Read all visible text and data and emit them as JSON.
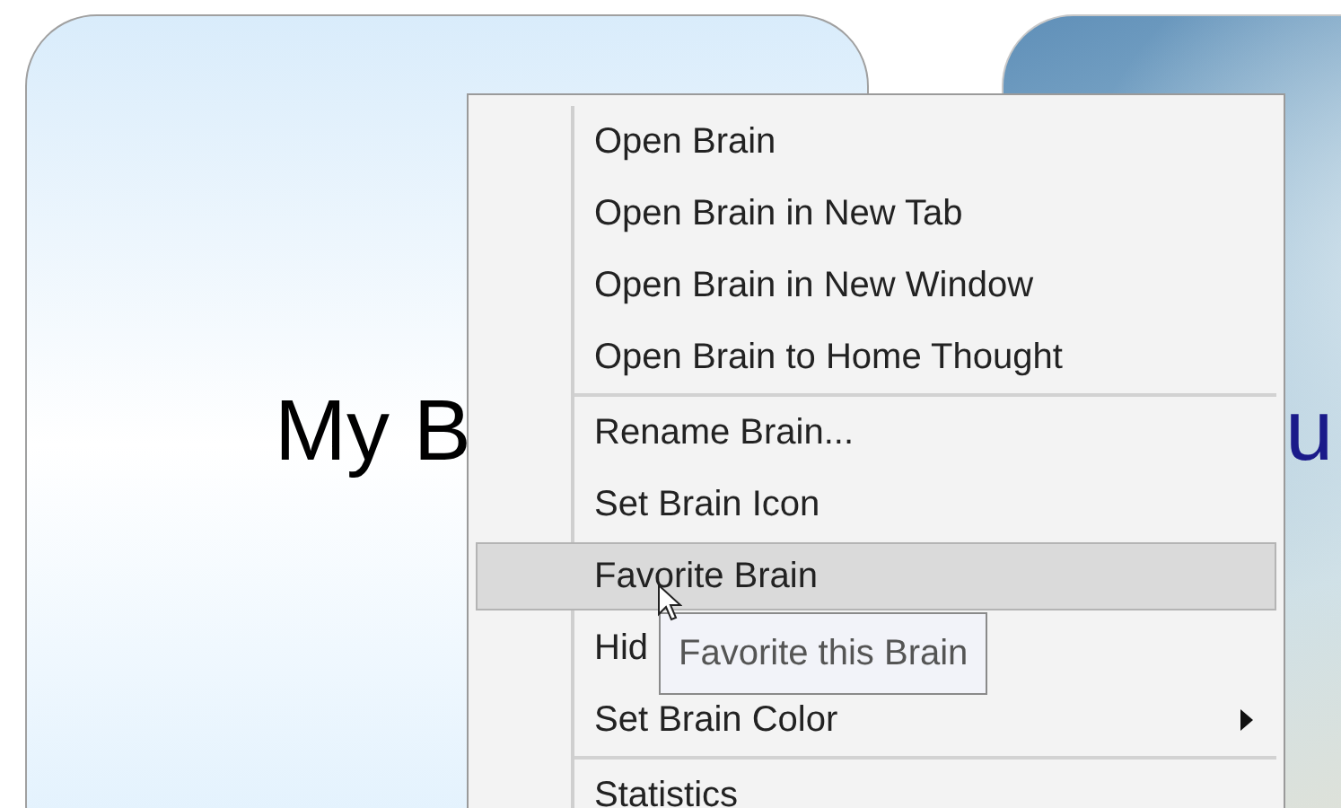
{
  "cards": [
    {
      "kind": "plain",
      "title": "My B"
    },
    {
      "kind": "photo",
      "title": "u"
    }
  ],
  "context_menu": {
    "items": [
      {
        "kind": "item",
        "label": "Open Brain",
        "selected": false,
        "submenu": false
      },
      {
        "kind": "item",
        "label": "Open Brain in New Tab",
        "selected": false,
        "submenu": false
      },
      {
        "kind": "item",
        "label": "Open Brain in New Window",
        "selected": false,
        "submenu": false
      },
      {
        "kind": "item",
        "label": "Open Brain to Home Thought",
        "selected": false,
        "submenu": false
      },
      {
        "kind": "separator"
      },
      {
        "kind": "item",
        "label": "Rename Brain...",
        "selected": false,
        "submenu": false
      },
      {
        "kind": "item",
        "label": "Set Brain Icon",
        "selected": false,
        "submenu": false
      },
      {
        "kind": "item",
        "label": "Favorite Brain",
        "selected": true,
        "submenu": false
      },
      {
        "kind": "item",
        "label": "Hid",
        "selected": false,
        "submenu": false
      },
      {
        "kind": "item",
        "label": "Set Brain Color",
        "selected": false,
        "submenu": true
      },
      {
        "kind": "separator"
      },
      {
        "kind": "item",
        "label": "Statistics",
        "selected": false,
        "submenu": false
      }
    ]
  },
  "tooltip": {
    "text": "Favorite this Brain"
  }
}
